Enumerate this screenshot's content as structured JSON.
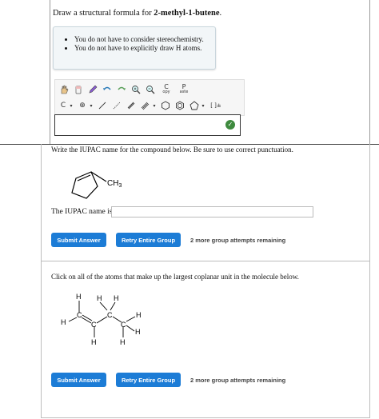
{
  "question1": {
    "prefix": "Draw a structural formula for ",
    "compound": "2-methyl-1-butene",
    "suffix": "."
  },
  "hints": [
    "You do not have to consider stereochemistry.",
    "You do not have to explicitly draw H atoms."
  ],
  "toolbar": {
    "row1": [
      "hand-icon",
      "eraser-icon",
      "pencil-icon",
      "undo-icon",
      "redo-icon",
      "zoom-in-icon",
      "zoom-out-icon"
    ],
    "copy": {
      "top": "C",
      "bottom": "opy"
    },
    "paste": {
      "top": "P",
      "bottom": "aste"
    },
    "atom_select": "C",
    "charge_symbol": "⊕",
    "bracket_label": "[ ]±"
  },
  "question2": {
    "text": "Write the IUPAC name for the compound below. Be sure to use correct punctuation.",
    "substituent": "CH",
    "substituent_sub": "3",
    "label": "The IUPAC name is",
    "input_value": "",
    "submit": "Submit Answer",
    "retry": "Retry Entire Group",
    "attempts": "2 more group attempts remaining"
  },
  "question3": {
    "text": "Click on all of the atoms that make up the largest coplanar unit in the molecule below.",
    "atoms": {
      "H": "H",
      "C": "C"
    },
    "submit": "Submit Answer",
    "retry": "Retry Entire Group",
    "attempts": "2 more group attempts remaining"
  },
  "colors": {
    "button": "#1c7cd6",
    "ok": "#3e8a3e"
  }
}
